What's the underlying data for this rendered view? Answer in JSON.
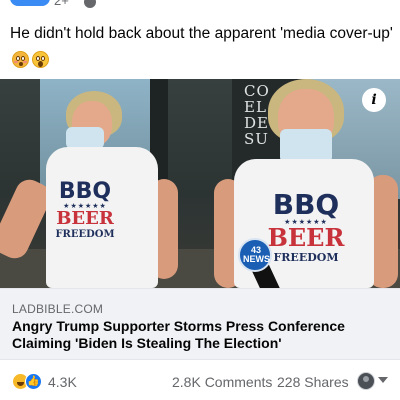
{
  "post": {
    "caption": "He didn't hold back about the apparent 'media cover-up'",
    "caption_emojis": [
      "flushed-face-icon",
      "astonished-face-icon"
    ]
  },
  "top_strip": {
    "cut_count": "2+"
  },
  "photo": {
    "sign_text": "CO\nEL\nDE\nSU",
    "left_shirt": {
      "line1": "BBQ",
      "line2": "BEER",
      "line3": "FREEDOM"
    },
    "right_shirt": {
      "line1": "BBQ",
      "line2": "BEER",
      "line3": "FREEDOM"
    },
    "stars": "★★★★★★",
    "mic_label": "43 NEWS",
    "info_icon": "i"
  },
  "link": {
    "domain": "LADBIBLE.COM",
    "headline": "Angry Trump Supporter Storms Press Conference Claiming 'Biden Is Stealing The Election'"
  },
  "footer": {
    "reaction_icons": [
      "haha-icon",
      "like-icon"
    ],
    "like_glyph": "👍",
    "reaction_count": "4.3K",
    "comments": "2.8K Comments",
    "shares": "228 Shares"
  },
  "colors": {
    "facebook_blue": "#1877f2",
    "secondary_text": "#65676b",
    "link_bg": "#f0f2f5",
    "shirt_navy": "#1f2f5c",
    "shirt_red": "#c8323b"
  }
}
